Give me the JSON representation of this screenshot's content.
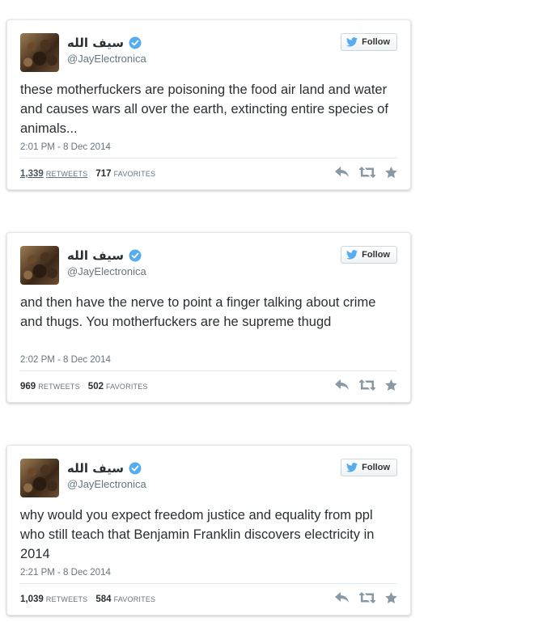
{
  "tweets": [
    {
      "display_name": "سيف الله",
      "handle": "@JayElectronica",
      "follow_label": "Follow",
      "text": "these motherfuckers are poisoning the food air land and water and causes wars all over the earth, extincting entire species of animals...",
      "timestamp": "2:01 PM - 8 Dec 2014",
      "retweets": "1,339",
      "retweets_label": "RETWEETS",
      "favorites": "717",
      "favorites_label": "FAVORITES"
    },
    {
      "display_name": "سيف الله",
      "handle": "@JayElectronica",
      "follow_label": "Follow",
      "text": "and then have the nerve to point a finger talking about crime and thugs. You motherfuckers are he supreme thugd",
      "timestamp": "2:02 PM - 8 Dec 2014",
      "retweets": "969",
      "retweets_label": "RETWEETS",
      "favorites": "502",
      "favorites_label": "FAVORITES"
    },
    {
      "display_name": "سيف الله",
      "handle": "@JayElectronica",
      "follow_label": "Follow",
      "text": "why would you expect freedom justice and equality from ppl who still teach that Benjamin Franklin discovers electricity in 2014",
      "timestamp": "2:21 PM - 8 Dec 2014",
      "retweets": "1,039",
      "retweets_label": "RETWEETS",
      "favorites": "584",
      "favorites_label": "FAVORITES"
    }
  ],
  "colors": {
    "verified": "#55acee",
    "twitter_bird": "#55acee",
    "action_icons": "#8899a6"
  },
  "icons": [
    "verified-badge-icon",
    "twitter-bird-icon",
    "reply-icon",
    "retweet-icon",
    "favorite-star-icon"
  ]
}
